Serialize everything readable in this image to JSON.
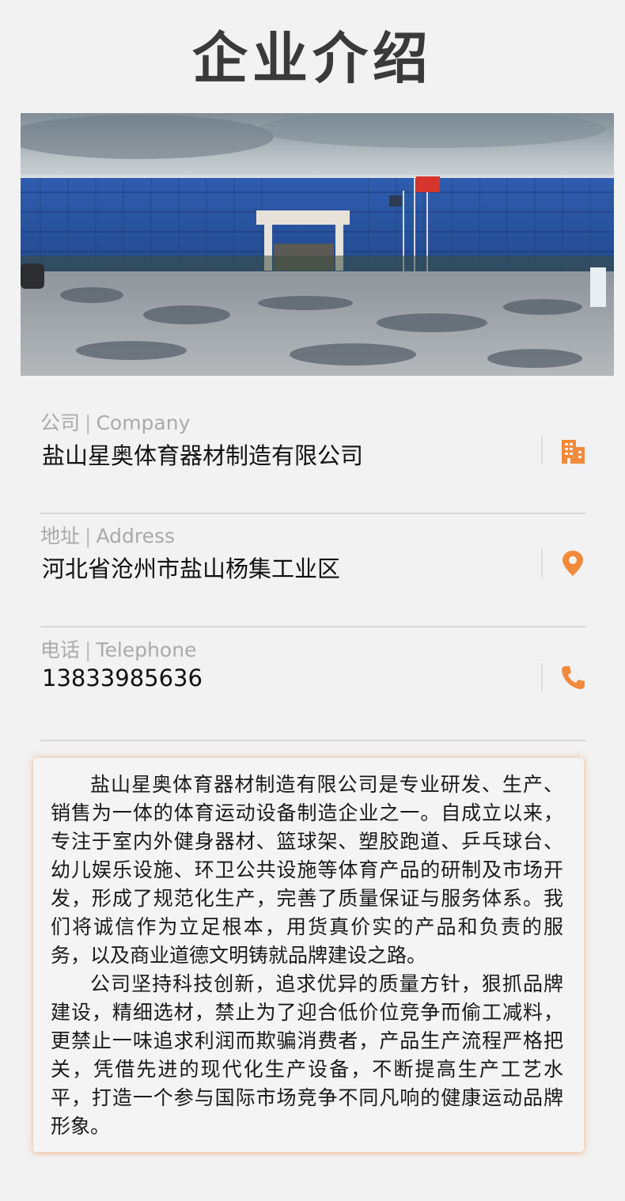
{
  "page": {
    "title": "企业介绍"
  },
  "info": {
    "company": {
      "label": "公司",
      "label_en": "Company",
      "value": "盐山星奥体育器材制造有限公司",
      "icon": "building-icon"
    },
    "address": {
      "label": "地址",
      "label_en": "Address",
      "value": "河北省沧州市盐山杨集工业区",
      "icon": "location-pin-icon"
    },
    "phone": {
      "label": "电话",
      "label_en": "Telephone",
      "value": "13833985636",
      "icon": "phone-icon"
    },
    "separator": "|",
    "accent_color": "#f28a3b"
  },
  "intro": {
    "paragraphs": [
      "盐山星奥体育器材制造有限公司是专业研发、生产、销售为一体的体育运动设备制造企业之一。自成立以来，专注于室内外健身器材、篮球架、塑胶跑道、乒乓球台、幼儿娱乐设施、环卫公共设施等体育产品的研制及市场开发，形成了规范化生产，完善了质量保证与服务体系。我们将诚信作为立足根本，用货真价实的产品和负责的服务，以及商业道德文明铸就品牌建设之路。",
      "公司坚持科技创新，追求优异的质量方针，狠抓品牌建设，精细选材，禁止为了迎合低价位竞争而偷工减料，更禁止一味追求利润而欺骗消费者，产品生产流程严格把关，凭借先进的现代化生产设备，不断提高生产工艺水平，打造一个参与国际市场竞争不同凡响的健康运动品牌形象。"
    ]
  }
}
